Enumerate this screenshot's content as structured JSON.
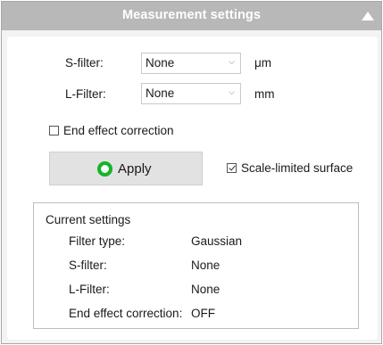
{
  "header": {
    "title": "Measurement settings",
    "collapse_icon": "triangle-up-icon"
  },
  "filters": {
    "s_filter": {
      "label": "S-filter:",
      "value": "None",
      "unit": "μm"
    },
    "l_filter": {
      "label": "L-Filter:",
      "value": "None",
      "unit": "mm"
    }
  },
  "end_effect": {
    "label": "End effect correction",
    "checked": false
  },
  "apply": {
    "label": "Apply",
    "icon": "green-circle-icon",
    "icon_color": "#11b52a"
  },
  "scale_limited": {
    "label": "Scale-limited surface",
    "checked": true
  },
  "current_settings": {
    "title": "Current settings",
    "rows": [
      {
        "key": "Filter type:",
        "value": "Gaussian"
      },
      {
        "key": "S-filter:",
        "value": "None"
      },
      {
        "key": "L-Filter:",
        "value": "None"
      },
      {
        "key": "End effect correction:",
        "value": "OFF"
      }
    ]
  }
}
